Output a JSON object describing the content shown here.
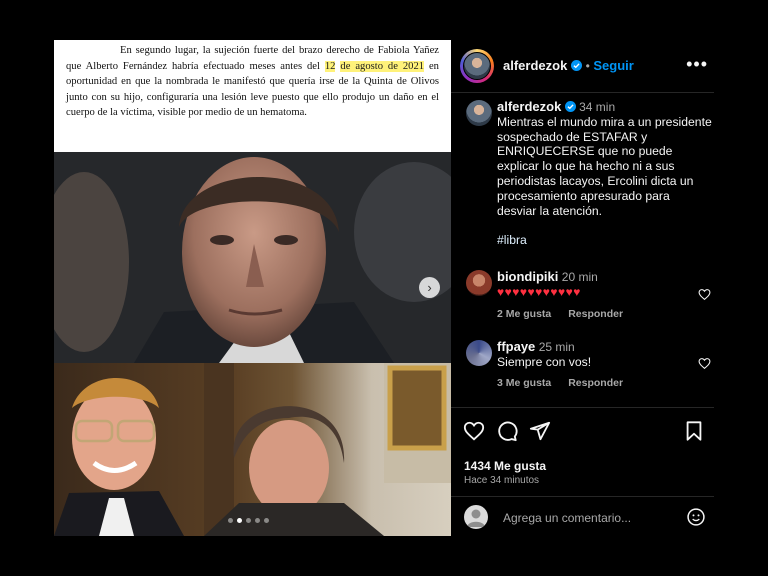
{
  "document_excerpt": {
    "part1": "En segundo lugar, la sujeción fuerte del brazo derecho de Fabiola Yañez que Alberto Fernández habría efectuado meses antes del ",
    "highlight_a": "12",
    "highlight_b": "de agosto de 2021",
    "part2": " en oportunidad en que la nombrada le manifestó que quería irse de la Quinta de Olivos junto con su hijo, configuraría una lesión leve puesto que ello produjo un daño en el cuerpo de la víctima, visible por medio de un hematoma."
  },
  "carousel": {
    "next_arrow": "›",
    "dot_count": 5,
    "active_dot": 1
  },
  "header": {
    "username": "alferdezok",
    "separator": "•",
    "follow_label": "Seguir",
    "more_label": "•••"
  },
  "caption": {
    "username": "alferdezok",
    "time": "34 min",
    "text": "Mientras el mundo mira a un presidente sospechado de ESTAFAR y ENRIQUECERSE que no puede explicar lo que ha hecho ni a sus periodistas lacayos, Ercolini dicta un procesamiento apresurado para desviar la atención.",
    "hashtag": "#libra"
  },
  "comments": [
    {
      "username": "biondipiki",
      "time": "20 min",
      "text": "♥♥♥♥♥♥♥♥♥♥♥",
      "likes": "2 Me gusta",
      "reply": "Responder"
    },
    {
      "username": "ffpaye",
      "time": "25 min",
      "text": "Siempre con vos!",
      "likes": "3 Me gusta",
      "reply": "Responder"
    }
  ],
  "stats": {
    "likes": "1434 Me gusta",
    "posted_ago": "Hace 34 minutos"
  },
  "comment_box": {
    "placeholder": "Agrega un comentario..."
  },
  "colors": {
    "accent": "#0095f6",
    "heart": "#ff3040",
    "highlight": "#fff27a",
    "background": "#000000"
  }
}
